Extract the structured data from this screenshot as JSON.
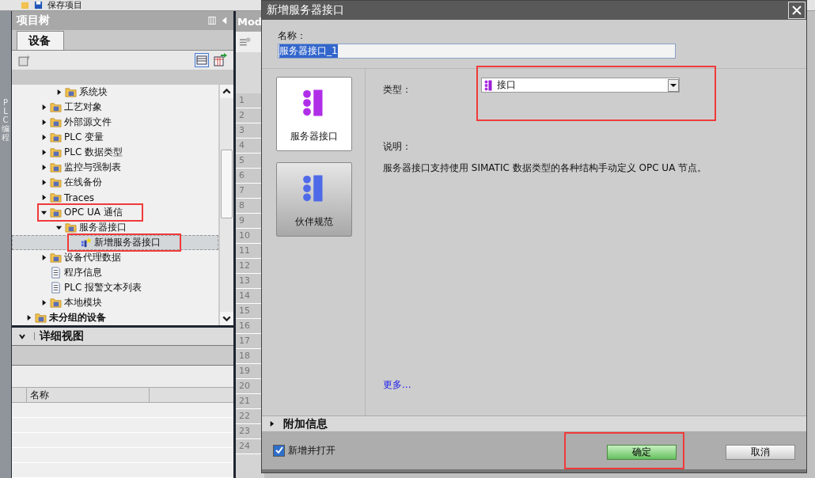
{
  "toolbar": {
    "save_label": "保存项目"
  },
  "side_tab": "PLC 编程",
  "project_tree": {
    "title": "项目树",
    "tabs": [
      {
        "label": "设备",
        "selected": true
      }
    ],
    "tree": [
      {
        "children": [
          {
            "children": [
              {
                "label": "系统块",
                "kind": "folder",
                "expanded": false,
                "selected": false,
                "annotated": false
              }
            ]
          },
          {
            "label": "工艺对象",
            "kind": "folder",
            "expanded": false,
            "selected": false,
            "annotated": false
          },
          {
            "label": "外部源文件",
            "kind": "folder",
            "expanded": false,
            "selected": false,
            "annotated": false
          },
          {
            "label": "PLC 变量",
            "kind": "folder",
            "expanded": false,
            "selected": false,
            "annotated": false
          },
          {
            "label": "PLC 数据类型",
            "kind": "folder",
            "expanded": false,
            "selected": false,
            "annotated": false
          },
          {
            "label": "监控与强制表",
            "kind": "folder",
            "expanded": false,
            "selected": false,
            "annotated": false
          },
          {
            "label": "在线备份",
            "kind": "folder",
            "expanded": false,
            "selected": false,
            "annotated": false
          },
          {
            "label": "Traces",
            "kind": "folder",
            "expanded": false,
            "selected": false,
            "annotated": false
          },
          {
            "label": "OPC UA 通信",
            "kind": "folder",
            "expanded": true,
            "selected": false,
            "annotated": true,
            "children": [
              {
                "label": "服务器接口",
                "kind": "folder",
                "expanded": true,
                "selected": false,
                "annotated": false,
                "children": [
                  {
                    "label": "新增服务器接口",
                    "kind": "action",
                    "selected": true,
                    "annotated": true
                  }
                ]
              }
            ]
          },
          {
            "label": "设备代理数据",
            "kind": "folder",
            "expanded": false,
            "selected": false,
            "annotated": false
          },
          {
            "label": "程序信息",
            "kind": "leaf",
            "selected": false,
            "annotated": false
          },
          {
            "label": "PLC 报警文本列表",
            "kind": "leaf",
            "selected": false,
            "annotated": false
          },
          {
            "label": "本地模块",
            "kind": "folder",
            "expanded": false,
            "selected": false,
            "annotated": false
          }
        ]
      },
      {
        "label": "未分组的设备",
        "kind": "group",
        "expanded": false,
        "selected": false,
        "annotated": false
      }
    ]
  },
  "detail_view": {
    "title": "详细视图",
    "expanded": true,
    "columns": [
      "名称"
    ]
  },
  "editor": {
    "tab": "Mod",
    "row_numbers": [
      "1",
      "2",
      "3",
      "4",
      "5",
      "6",
      "7",
      "8",
      "9",
      "10",
      "11",
      "12",
      "13",
      "14",
      "15",
      "16",
      "17",
      "18",
      "19",
      "20",
      "21",
      "22",
      "23",
      "24"
    ]
  },
  "dialog": {
    "title": "新增服务器接口",
    "name_label": "名称：",
    "name_value": "服务器接口_1",
    "name_selected": true,
    "types": [
      {
        "label": "服务器接口",
        "selected": true,
        "color": "#b02ee8"
      },
      {
        "label": "伙伴规范",
        "selected": false,
        "color": "#4f6ae8"
      }
    ],
    "type_label": "类型：",
    "type_value": "接口",
    "type_annotated": true,
    "description_label": "说明：",
    "description": "服务器接口支持使用 SIMATIC 数据类型的各种结构手动定义 OPC UA 节点。",
    "more_link": "更多...",
    "additional_info": {
      "label": "附加信息",
      "expanded": false
    },
    "open_after_add": {
      "label": "新增并打开",
      "checked": true
    },
    "buttons": [
      {
        "label": "确定",
        "kind": "primary",
        "annotated": true
      },
      {
        "label": "取消",
        "kind": "secondary",
        "annotated": false
      }
    ]
  }
}
